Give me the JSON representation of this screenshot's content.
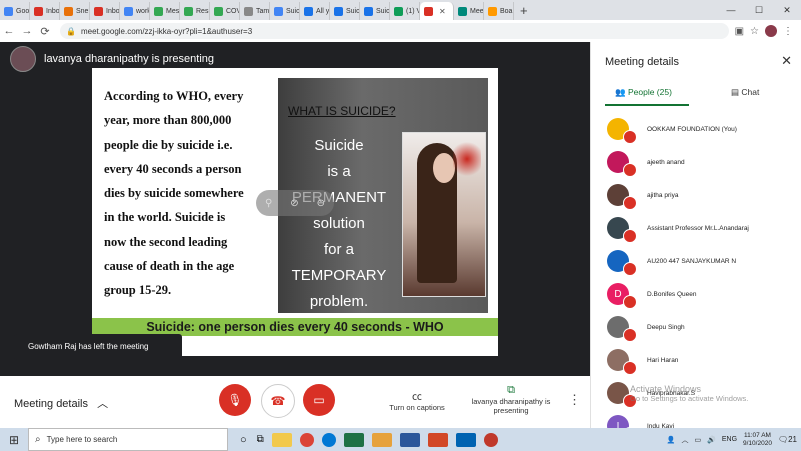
{
  "browser": {
    "tabs": [
      {
        "label": "Goo",
        "color": "#4285f4"
      },
      {
        "label": "Inbo",
        "color": "#d93025"
      },
      {
        "label": "Sneh",
        "color": "#e8710a"
      },
      {
        "label": "Inbo",
        "color": "#d93025"
      },
      {
        "label": "work",
        "color": "#4285f4"
      },
      {
        "label": "Mes",
        "color": "#34a853"
      },
      {
        "label": "Resi",
        "color": "#34a853"
      },
      {
        "label": "COV",
        "color": "#34a853"
      },
      {
        "label": "Tami",
        "color": "#888888"
      },
      {
        "label": "Suici",
        "color": "#4285f4"
      },
      {
        "label": "All y",
        "color": "#1a73e8"
      },
      {
        "label": "Suic",
        "color": "#1a73e8"
      },
      {
        "label": "Suic",
        "color": "#1a73e8"
      },
      {
        "label": "(1) V",
        "color": "#0f9d58"
      },
      {
        "label": "",
        "color": "#d93025",
        "active": true
      },
      {
        "label": "Mee",
        "color": "#00897b"
      },
      {
        "label": "Boa",
        "color": "#ff9900"
      }
    ],
    "new_tab": "+",
    "window_controls": [
      "—",
      "☐",
      "✕"
    ],
    "url": "meet.google.com/zzj-ikka-oyr?pli=1&authuser=3"
  },
  "meeting": {
    "presenter_label": "lavanya dharanipathy is presenting",
    "toast": "Gowtham Raj has left the meeting",
    "slide": {
      "text_lines": [
        "According to WHO, every",
        "year, more than 800,000",
        "people die by suicide i.e.",
        "every 40 seconds a person",
        "dies by suicide somewhere",
        "in the world.  Suicide is",
        "now the second leading",
        "cause of death in the age",
        "group 15-29."
      ],
      "panel_heading": "WHAT IS SUICIDE?",
      "panel_lines": [
        "Suicide",
        "is a",
        "PERMANENT",
        "solution",
        "for a",
        "TEMPORARY",
        "problem."
      ],
      "footer": "Suicide: one person dies every 40 seconds - WHO"
    },
    "bottom": {
      "details_label": "Meeting details",
      "captions_label": "Turn on captions",
      "presenting_label": "lavanya dharanipathy is presenting"
    }
  },
  "side_panel": {
    "title": "Meeting details",
    "people_tab": "People (25)",
    "chat_tab": "Chat",
    "participants": [
      {
        "name": "OOKKAM FOUNDATION (You)",
        "color": "#f4b400"
      },
      {
        "name": "ajeeth anand",
        "color": "#c2185b"
      },
      {
        "name": "ajitha priya",
        "color": "#5d4037"
      },
      {
        "name": "Assistant Professor Mr.L.Anandaraj",
        "color": "#37474f"
      },
      {
        "name": "AU200 447 SANJAYKUMAR N",
        "color": "#1565c0"
      },
      {
        "name": "D.Bonifes Queen",
        "color": "#e91e63",
        "initial": "D"
      },
      {
        "name": "Deepu Singh",
        "color": "#6d6d6d"
      },
      {
        "name": "Hari Haran",
        "color": "#8d6e63"
      },
      {
        "name": "Haviprabhakar.S",
        "color": "#795548"
      },
      {
        "name": "Indu Kavi",
        "color": "#7e57c2",
        "initial": "I"
      }
    ],
    "watermark_line1": "Activate Windows",
    "watermark_line2": "Go to Settings to activate Windows."
  },
  "taskbar": {
    "search_placeholder": "Type here to search",
    "time": "11:07 AM",
    "date": "9/10/2020",
    "lang": "ENG",
    "notifications": "21"
  }
}
